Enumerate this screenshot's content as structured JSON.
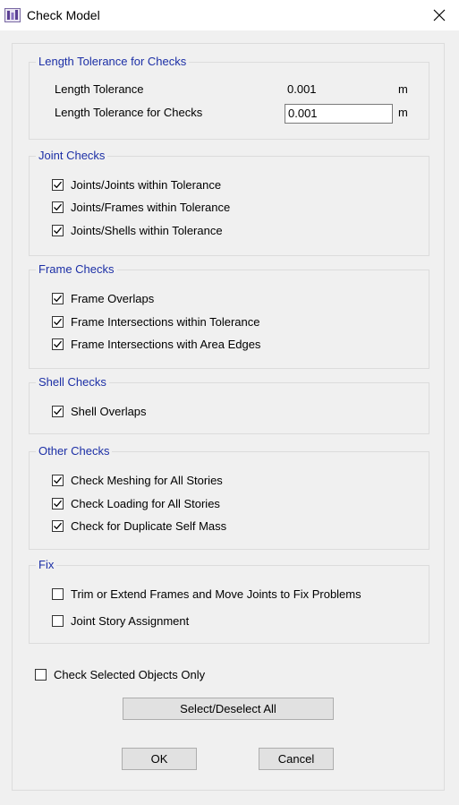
{
  "window": {
    "title": "Check Model"
  },
  "length_tolerance": {
    "legend": "Length Tolerance for Checks",
    "tolerance_label": "Length Tolerance",
    "tolerance_value": "0.001",
    "tolerance_unit": "m",
    "checks_label": "Length Tolerance for Checks",
    "checks_value": "0.001",
    "checks_unit": "m"
  },
  "joint_checks": {
    "legend": "Joint Checks",
    "items": [
      {
        "label": "Joints/Joints within Tolerance",
        "checked": true
      },
      {
        "label": "Joints/Frames within Tolerance",
        "checked": true
      },
      {
        "label": "Joints/Shells within Tolerance",
        "checked": true
      }
    ]
  },
  "frame_checks": {
    "legend": "Frame Checks",
    "items": [
      {
        "label": "Frame Overlaps",
        "checked": true
      },
      {
        "label": "Frame Intersections within Tolerance",
        "checked": true
      },
      {
        "label": "Frame Intersections with Area Edges",
        "checked": true
      }
    ]
  },
  "shell_checks": {
    "legend": "Shell Checks",
    "items": [
      {
        "label": "Shell Overlaps",
        "checked": true
      }
    ]
  },
  "other_checks": {
    "legend": "Other Checks",
    "items": [
      {
        "label": "Check Meshing for All Stories",
        "checked": true
      },
      {
        "label": "Check Loading for All Stories",
        "checked": true
      },
      {
        "label": "Check for Duplicate Self Mass",
        "checked": true
      }
    ]
  },
  "fix": {
    "legend": "Fix",
    "items": [
      {
        "label": "Trim or Extend Frames and Move Joints to Fix Problems",
        "checked": false
      },
      {
        "label": "Joint Story Assignment",
        "checked": false
      }
    ]
  },
  "selected_only": {
    "label": "Check Selected Objects Only",
    "checked": false
  },
  "buttons": {
    "select_all": "Select/Deselect All",
    "ok": "OK",
    "cancel": "Cancel"
  }
}
